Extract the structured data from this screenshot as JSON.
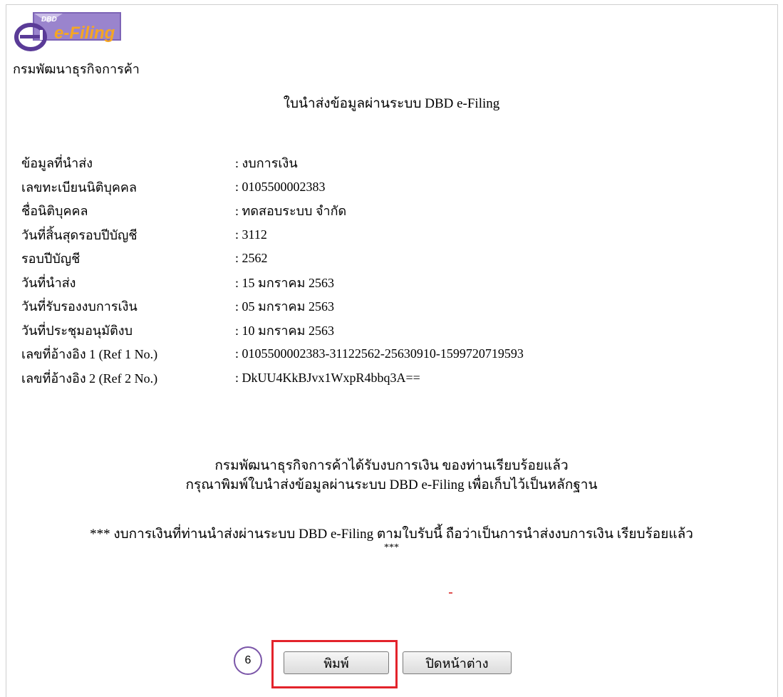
{
  "header": {
    "logo_text_dbd": "DBD",
    "logo_text_efiling": "e-Filing",
    "organization": "กรมพัฒนาธุรกิจการค้า",
    "document_title": "ใบนำส่งข้อมูลผ่านระบบ DBD e-Filing"
  },
  "fields": [
    {
      "label": "ข้อมูลที่นำส่ง",
      "value": ": งบการเงิน"
    },
    {
      "label": "เลขทะเบียนนิติบุคคล",
      "value": ": 0105500002383"
    },
    {
      "label": "ชื่อนิติบุคคล",
      "value": ": ทดสอบระบบ จำกัด"
    },
    {
      "label": "วันที่สิ้นสุดรอบปีบัญชี",
      "value": ": 3112"
    },
    {
      "label": "รอบปีบัญชี",
      "value": ": 2562"
    },
    {
      "label": "วันที่นำส่ง",
      "value": ": 15 มกราคม 2563"
    },
    {
      "label": "วันที่รับรองงบการเงิน",
      "value": ": 05 มกราคม 2563"
    },
    {
      "label": "วันที่ประชุมอนุมัติงบ",
      "value": ": 10 มกราคม 2563"
    },
    {
      "label": "เลขที่อ้างอิง 1 (Ref 1 No.)",
      "value": ": 0105500002383-31122562-25630910-1599720719593"
    },
    {
      "label": "เลขที่อ้างอิง 2 (Ref 2 No.)",
      "value": ": DkUU4KkBJvx1WxpR4bbq3A=="
    }
  ],
  "message": {
    "line1": "กรมพัฒนาธุรกิจการค้าได้รับงบการเงิน ของท่านเรียบร้อยแล้ว",
    "line2": "กรุณาพิมพ์ใบนำส่งข้อมูลผ่านระบบ DBD e-Filing เพื่อเก็บไว้เป็นหลักฐาน"
  },
  "note": {
    "line1": "*** งบการเงินที่ท่านนำส่งผ่านระบบ DBD e-Filing ตามใบรับนี้ ถือว่าเป็นการนำส่งงบการเงิน เรียบร้อยแล้ว",
    "line2": "***"
  },
  "actions": {
    "step_number": "6",
    "print_label": "พิมพ์",
    "close_label": "ปิดหน้าต่าง"
  },
  "colors": {
    "highlight": "#e3232b",
    "step_badge": "#7a55a8",
    "logo_orange": "#f5a623",
    "logo_purple": "#6a4ca3"
  }
}
